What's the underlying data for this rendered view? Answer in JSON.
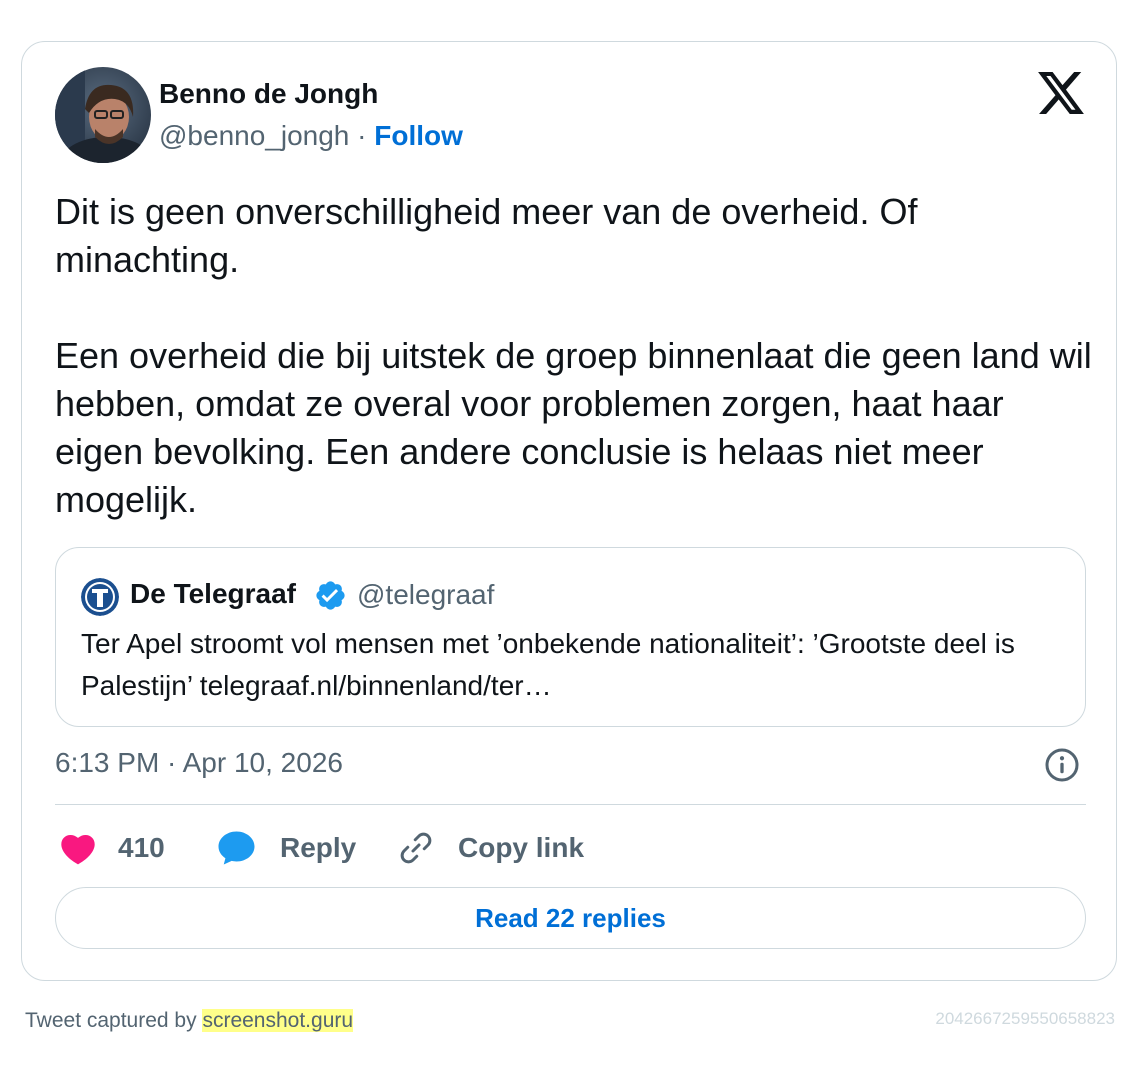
{
  "author": {
    "name": "Benno de Jongh",
    "handle": "@benno_jongh",
    "separator": "·",
    "follow_label": "Follow"
  },
  "tweet": {
    "paragraphs": [
      "Dit is geen onverschilligheid meer van de overheid. Of minachting.",
      "Een overheid die bij uitstek de groep binnenlaat die geen land wil hebben, omdat ze overal voor problemen zorgen, haat haar eigen bevolking. Een andere conclusie is helaas niet meer mogelijk."
    ],
    "timestamp": "6:13 PM · Apr 10, 2026"
  },
  "quoted_tweet": {
    "name": "De Telegraaf",
    "handle": "@telegraaf",
    "verified": true,
    "text": "Ter Apel stroomt vol mensen met ’onbekende nationaliteit’: ’Grootste deel is Palestijn’ telegraaf.nl/binnenland/ter…"
  },
  "actions": {
    "likes_count": "410",
    "reply_label": "Reply",
    "copy_link_label": "Copy link",
    "read_replies_label": "Read 22 replies"
  },
  "icons": {
    "brand": "x-logo-icon",
    "info": "info-icon",
    "like": "heart-icon",
    "reply": "speech-bubble-icon",
    "copy": "link-icon",
    "verified": "verified-badge-icon"
  },
  "colors": {
    "link": "#006fd6",
    "like": "#f91880",
    "reply": "#1d9bf0",
    "verified": "#1d9bf0",
    "muted": "#536471",
    "border": "#cfd9de",
    "highlight": "#ffff8a"
  },
  "footer": {
    "captured_by": "Tweet captured by",
    "brand": "screenshot.guru",
    "tweet_id": "2042667259550658823"
  }
}
